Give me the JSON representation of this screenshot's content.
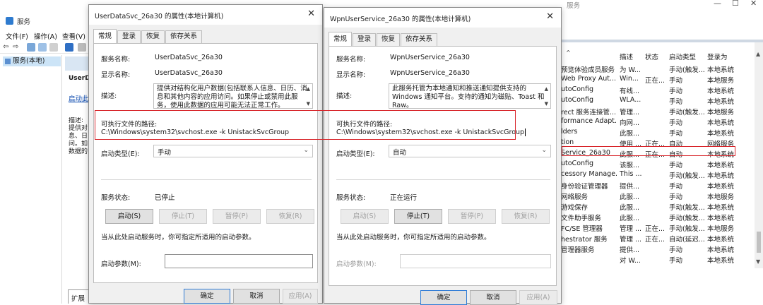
{
  "main_window": {
    "title": "服务",
    "menu": [
      "文件(F)",
      "操作(A)",
      "查看(V)"
    ],
    "tree_item": "服务(本地)",
    "detail_name": "UserDa",
    "detail_link": "启动此",
    "detail_desc": "描述:\n提供对\n息、日\n问。如\n数据的",
    "ext_tab": "扩展"
  },
  "services_list": {
    "window_title": "服务",
    "headers": [
      "描述",
      "状态",
      "启动类型",
      "登录为"
    ],
    "rows": [
      [
        "预览体验成员服务",
        "为 W...",
        "",
        "手动(触发...",
        "本地系统"
      ],
      [
        "Web Proxy Aut...",
        "Win...",
        "正在...",
        "手动",
        "本地服务"
      ],
      [
        "utoConfig",
        "有线...",
        "",
        "手动",
        "本地系统"
      ],
      [
        "utoConfig",
        "WLA...",
        "",
        "手动",
        "本地系统"
      ],
      [
        "rect 服务连接管...",
        "管理...",
        "",
        "手动(触发...",
        "本地服务"
      ],
      [
        "formance Adapt...",
        "向网...",
        "",
        "手动",
        "本地系统"
      ],
      [
        "lders",
        "此服...",
        "",
        "手动",
        "本地系统"
      ],
      [
        "tion",
        "使用 ...",
        "正在...",
        "自动",
        "网络服务"
      ],
      [
        "Service_26a30",
        "此服...",
        "正在...",
        "自动",
        "本地系统"
      ],
      [
        "utoConfig",
        "该服...",
        "",
        "手动",
        "本地系统"
      ],
      [
        "cessory Manage...",
        "This ...",
        "",
        "手动(触发...",
        "本地系统"
      ],
      [
        "身份验证管理器",
        "提供...",
        "",
        "手动",
        "本地系统"
      ],
      [
        "网络服务",
        "此服...",
        "",
        "手动",
        "本地服务"
      ],
      [
        "游戏保存",
        "此服...",
        "",
        "手动(触发...",
        "本地系统"
      ],
      [
        "文件助手服务",
        "此服...",
        "",
        "手动(触发...",
        "本地系统"
      ],
      [
        "FC/SE 管理器",
        "管理 ...",
        "正在...",
        "手动(触发...",
        "本地服务"
      ],
      [
        "hestrator 服务",
        "管理 ...",
        "正在...",
        "自动(延迟...",
        "本地系统"
      ],
      [
        "管理器服务",
        "提供...",
        "",
        "手动",
        "本地系统"
      ],
      [
        "",
        "对 W...",
        "",
        "手动",
        "本地系统"
      ]
    ]
  },
  "dialog_left": {
    "title": "UserDataSvc_26a30 的属性(本地计算机)",
    "tabs": [
      "常规",
      "登录",
      "恢复",
      "依存关系"
    ],
    "service_name_label": "服务名称:",
    "service_name": "UserDataSvc_26a30",
    "display_name_label": "显示名称:",
    "display_name": "UserDataSvc_26a30",
    "desc_label": "描述:",
    "desc": "提供对结构化用户数据(包括联系人信息、日历、消息和其他内容的应用访问。如果停止或禁用此服务，使用此数据的应用可能无法正常工作。",
    "path_label": "可执行文件的路径:",
    "path": "C:\\Windows\\system32\\svchost.exe -k UnistackSvcGroup",
    "startup_label": "启动类型(E):",
    "startup_value": "手动",
    "status_label": "服务状态:",
    "status_value": "已停止",
    "buttons": [
      "启动(S)",
      "停止(T)",
      "暂停(P)",
      "恢复(R)"
    ],
    "hint": "当从此处启动服务时，你可指定所适用的启动参数。",
    "param_label": "启动参数(M):",
    "ok": "确定",
    "cancel": "取消",
    "apply": "应用(A)"
  },
  "dialog_right": {
    "title": "WpnUserService_26a30 的属性(本地计算机)",
    "tabs": [
      "常规",
      "登录",
      "恢复",
      "依存关系"
    ],
    "service_name_label": "服务名称:",
    "service_name": "WpnUserService_26a30",
    "display_name_label": "显示名称:",
    "display_name": "WpnUserService_26a30",
    "desc_label": "描述:",
    "desc": "此服务托管为本地通知和推送通知提供支持的 Windows 通知平台。支持的通知为磁贴、Toast 和 Raw。",
    "path_label": "可执行文件的路径:",
    "path": "C:\\Windows\\system32\\svchost.exe -k UnistackSvcGroup",
    "startup_label": "启动类型(E):",
    "startup_value": "自动",
    "status_label": "服务状态:",
    "status_value": "正在运行",
    "buttons": [
      "启动(S)",
      "停止(T)",
      "暂停(P)",
      "恢复(R)"
    ],
    "hint": "当从此处启动服务时，你可指定所适用的启动参数。",
    "param_label": "启动参数(M):",
    "ok": "确定",
    "cancel": "取消",
    "apply": "应用(A)"
  },
  "colors": {
    "highlight_red": "#d8252b",
    "selection_blue": "#cce4f7",
    "accent_blue": "#2e7bd6"
  }
}
